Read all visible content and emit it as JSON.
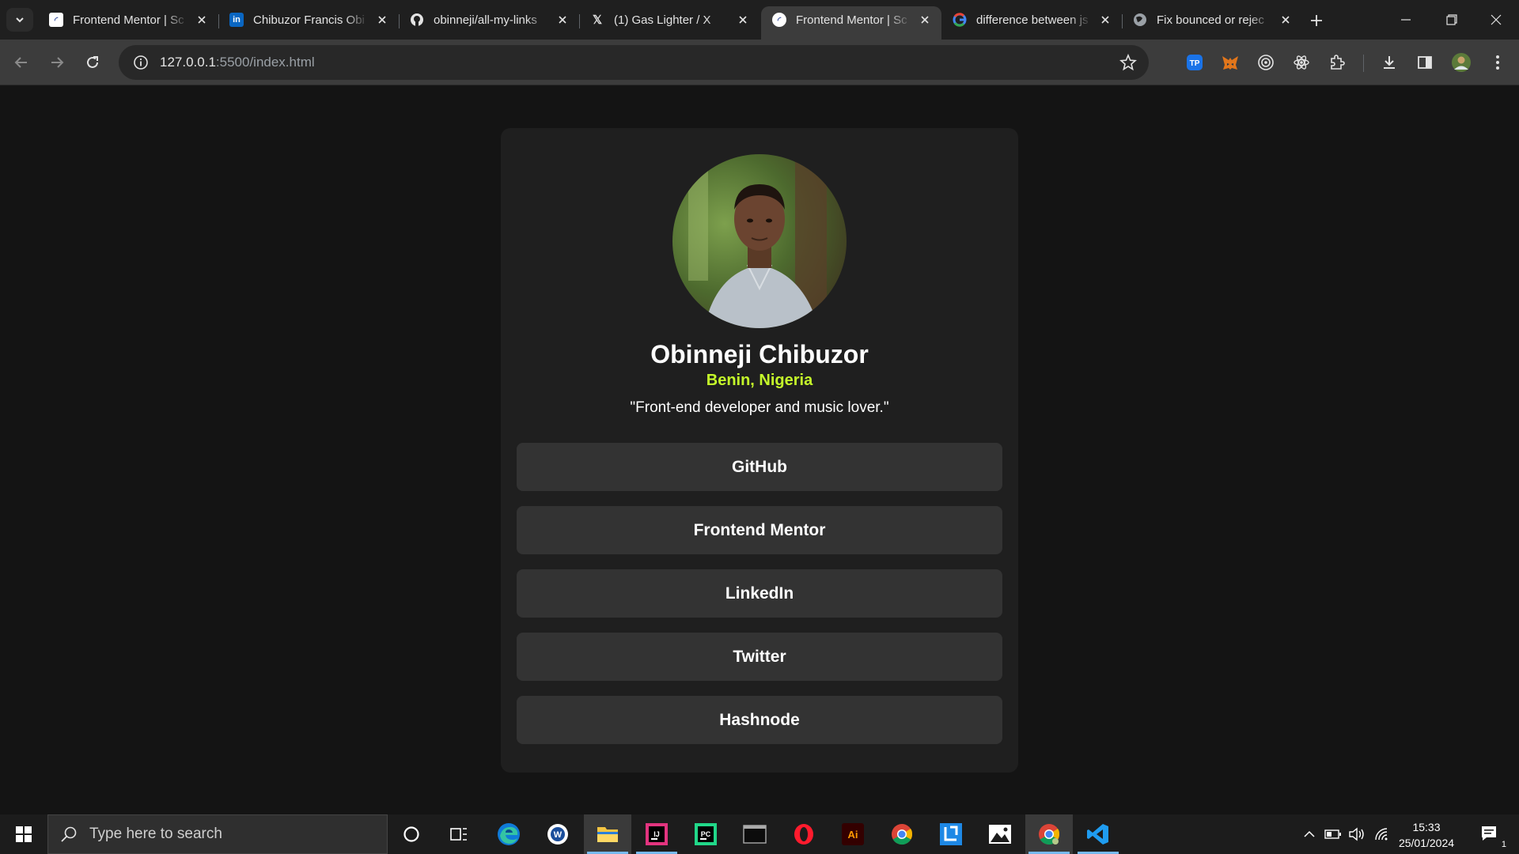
{
  "browser": {
    "tabs": [
      {
        "title": "Frontend Mentor | Sc",
        "favicon": "frontend-mentor-icon",
        "active": false
      },
      {
        "title": "Chibuzor Francis Obi",
        "favicon": "linkedin-icon",
        "active": false
      },
      {
        "title": "obinneji/all-my-links",
        "favicon": "github-icon",
        "active": false
      },
      {
        "title": "(1) Gas Lighter / X",
        "favicon": "x-icon",
        "active": false
      },
      {
        "title": "Frontend Mentor | Sc",
        "favicon": "frontend-mentor-icon",
        "active": true
      },
      {
        "title": "difference between js",
        "favicon": "google-icon",
        "active": false
      },
      {
        "title": "Fix bounced or rejec",
        "favicon": "globe-icon",
        "active": false
      }
    ],
    "url_host": "127.0.0.1",
    "url_rest": ":5500/index.html",
    "extensions": [
      "tp-icon",
      "metamask-icon",
      "target-icon",
      "react-icon",
      "puzzle-icon",
      "download-icon",
      "sidepanel-icon",
      "profile-avatar"
    ]
  },
  "profile": {
    "name": "Obinneji Chibuzor",
    "location": "Benin, Nigeria",
    "bio": "\"Front-end developer and music lover.\"",
    "accent_color": "#c4f82a",
    "links": [
      {
        "label": "GitHub"
      },
      {
        "label": "Frontend Mentor"
      },
      {
        "label": "LinkedIn"
      },
      {
        "label": "Twitter"
      },
      {
        "label": "Hashnode"
      }
    ]
  },
  "taskbar": {
    "search_placeholder": "Type here to search",
    "time": "15:33",
    "date": "25/01/2024",
    "notification_count": "1",
    "apps": [
      "cortana-icon",
      "task-view-icon",
      "edge-icon",
      "app-icon",
      "file-explorer-icon",
      "intellij-icon",
      "pycharm-icon",
      "terminal-icon",
      "opera-icon",
      "illustrator-icon",
      "chrome-icon",
      "linear-icon",
      "photos-icon",
      "chrome-running-icon",
      "vscode-icon"
    ]
  }
}
